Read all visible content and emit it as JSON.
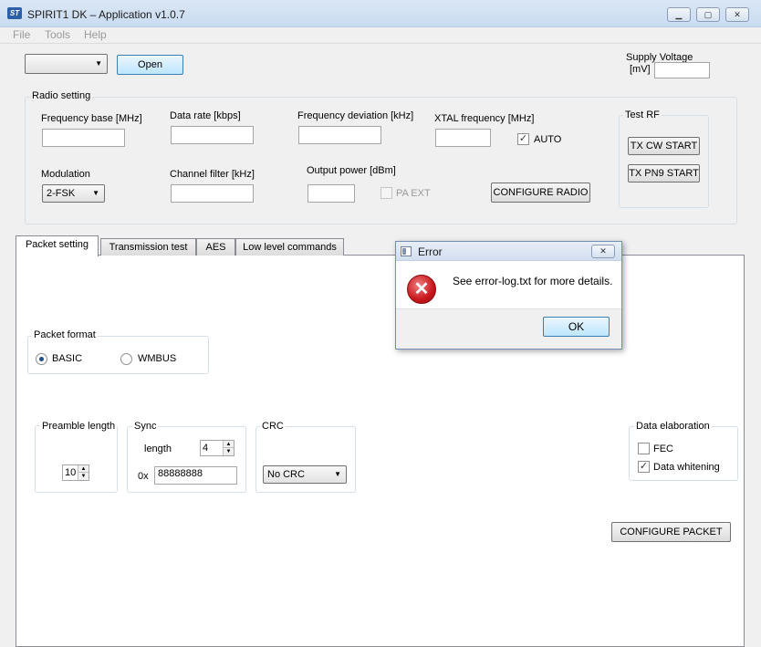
{
  "window": {
    "title": "SPIRIT1 DK – Application v1.0.7",
    "logo": "ST",
    "controls": [
      "minimize-icon",
      "restore-icon",
      "close-icon"
    ]
  },
  "menu": [
    "File",
    "Tools",
    "Help"
  ],
  "top": {
    "port_select": "",
    "open_button": "Open",
    "supply_label": "Supply Voltage",
    "supply_unit": "[mV]",
    "supply_value": ""
  },
  "radio": {
    "group_label": "Radio setting",
    "freq_base_label": "Frequency base [MHz]",
    "freq_base_value": "",
    "data_rate_label": "Data rate [kbps]",
    "data_rate_value": "",
    "freq_dev_label": "Frequency deviation [kHz]",
    "freq_dev_value": "",
    "xtal_label": "XTAL frequency [MHz]",
    "xtal_value": "",
    "auto_label": "AUTO",
    "auto_checked": true,
    "modulation_label": "Modulation",
    "modulation_value": "2-FSK",
    "channel_filter_label": "Channel filter [kHz]",
    "channel_filter_value": "",
    "output_power_label": "Output power [dBm]",
    "output_power_value": "",
    "pa_ext_label": "PA EXT",
    "configure_button": "CONFIGURE RADIO"
  },
  "test_rf": {
    "label": "Test RF",
    "cw_button": "TX CW START",
    "pn9_button": "TX PN9 START"
  },
  "tabs": [
    "Packet setting",
    "Transmission test",
    "AES",
    "Low level commands"
  ],
  "packet": {
    "format_label": "Packet format",
    "basic_label": "BASIC",
    "wmbus_label": "WMBUS",
    "selected": "BASIC",
    "preamble_label": "Preamble length",
    "preamble_value": "10",
    "sync_label": "Sync",
    "sync_length_label": "length",
    "sync_length_value": "4",
    "sync_hex_prefix": "0x",
    "sync_value": "88888888",
    "crc_label": "CRC",
    "crc_value": "No CRC",
    "elab_label": "Data elaboration",
    "fec_label": "FEC",
    "fec_checked": false,
    "whitening_label": "Data whitening",
    "whitening_checked": true,
    "configure_button": "CONFIGURE PACKET"
  },
  "dialog": {
    "title": "Error",
    "message": "See error-log.txt for more details.",
    "ok": "OK",
    "icon": "error-icon"
  },
  "colors": {
    "error_red": "#c8161d",
    "focus_blue": "#3c7fb1"
  }
}
